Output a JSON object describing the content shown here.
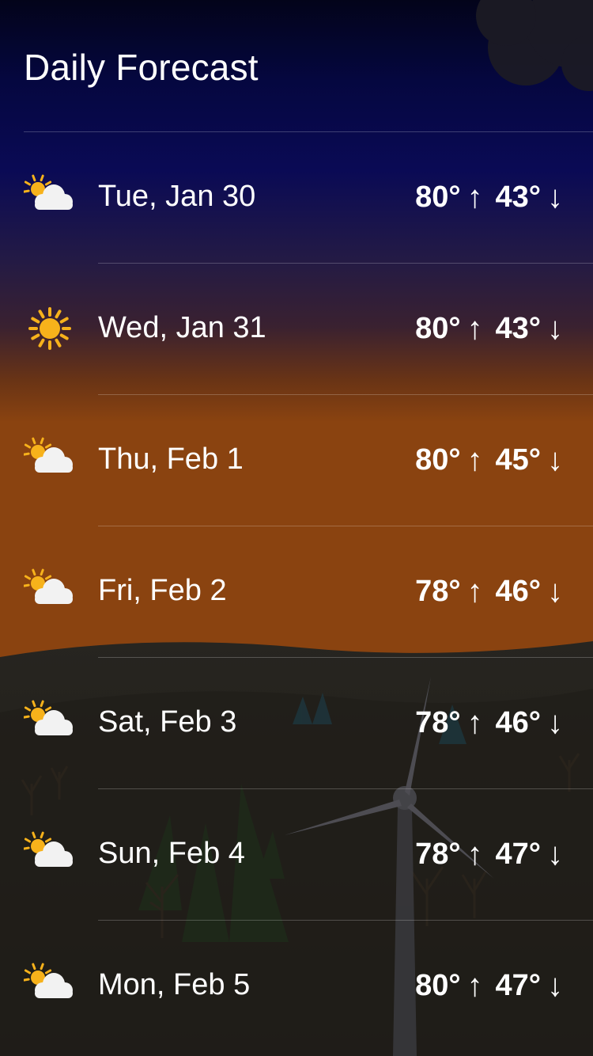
{
  "header": {
    "title": "Daily Forecast"
  },
  "forecast": [
    {
      "date": "Tue, Jan 30",
      "icon": "partly-cloudy-icon",
      "high": "80°",
      "low": "43°"
    },
    {
      "date": "Wed, Jan 31",
      "icon": "sunny-icon",
      "high": "80°",
      "low": "43°"
    },
    {
      "date": "Thu, Feb 1",
      "icon": "partly-cloudy-icon",
      "high": "80°",
      "low": "45°"
    },
    {
      "date": "Fri, Feb 2",
      "icon": "partly-cloudy-icon",
      "high": "78°",
      "low": "46°"
    },
    {
      "date": "Sat, Feb 3",
      "icon": "partly-cloudy-icon",
      "high": "78°",
      "low": "46°"
    },
    {
      "date": "Sun, Feb 4",
      "icon": "partly-cloudy-icon",
      "high": "78°",
      "low": "47°"
    },
    {
      "date": "Mon, Feb 5",
      "icon": "partly-cloudy-icon",
      "high": "80°",
      "low": "47°"
    }
  ],
  "symbols": {
    "high_arrow": "↑",
    "low_arrow": "↓"
  },
  "colors": {
    "sky_top": "#04061f",
    "sky_mid": "#1b1740",
    "sky_dusk": "#7a3d12",
    "ground": "#1f1c17",
    "sun": "#f7b21b",
    "cloud": "#f2f2f2"
  }
}
